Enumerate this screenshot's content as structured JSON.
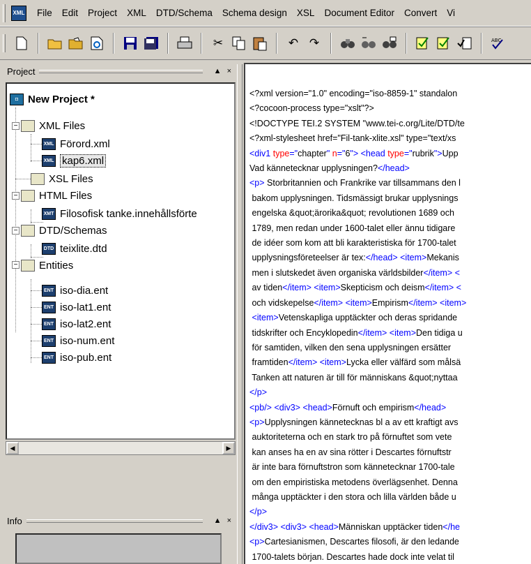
{
  "menu": {
    "app_icon": "XML",
    "items": [
      "File",
      "Edit",
      "Project",
      "XML",
      "DTD/Schema",
      "Schema design",
      "XSL",
      "Document Editor",
      "Convert",
      "Vi"
    ]
  },
  "toolbar": {
    "buttons": [
      "new-file-icon",
      "open-icon",
      "open-url-icon",
      "reload-icon",
      "save-icon",
      "save-all-icon",
      "print-icon",
      "cut-icon",
      "copy-icon",
      "paste-icon",
      "undo-icon",
      "redo-icon",
      "find-icon",
      "find-next-icon",
      "replace-icon",
      "check-wellformed-icon",
      "validate-icon",
      "validate-all-icon",
      "spellcheck-icon"
    ]
  },
  "project_panel": {
    "title": "Project",
    "controls": [
      "▲",
      "×"
    ],
    "tree": {
      "root": "New Project *",
      "xml_folder": "XML Files",
      "xml_files": [
        "Förord.xml",
        "kap6.xml"
      ],
      "xsl_folder": "XSL Files",
      "html_folder": "HTML Files",
      "html_files": [
        "Filosofisk tanke.innehållsförte"
      ],
      "dtd_folder": "DTD/Schemas",
      "dtd_files": [
        "teixlite.dtd"
      ],
      "ent_folder": "Entities",
      "ent_files": [
        "iso-dia.ent",
        "iso-lat1.ent",
        "iso-lat2.ent",
        "iso-num.ent",
        "iso-pub.ent"
      ]
    },
    "icon_labels": {
      "xml": "XML",
      "xmt": "XMT",
      "dtd": "DTD",
      "ent": "ENT"
    }
  },
  "info_panel": {
    "title": "Info",
    "controls": [
      "▲",
      "×"
    ]
  },
  "editor": {
    "lines": [
      [
        [
          "x",
          "<?xml version=\"1.0\" encoding=\"iso-8859-1\" standalon"
        ]
      ],
      [
        [
          "x",
          "<?cocoon-process type=\"xslt\"?>"
        ]
      ],
      [
        [
          "x",
          "<!DOCTYPE TEI.2 SYSTEM \"www.tei-c.org/Lite/DTD/te"
        ]
      ],
      [
        [
          "x",
          "<?xml-stylesheet href=\"Fil-tank-xlite.xsl\" type=\"text/xs"
        ]
      ],
      [
        [
          "t",
          "<div1 "
        ],
        [
          "a",
          "type"
        ],
        [
          "t",
          "=\""
        ],
        [
          "x",
          "chapter"
        ],
        [
          "t",
          "\" "
        ],
        [
          "a",
          "n"
        ],
        [
          "t",
          "=\""
        ],
        [
          "x",
          "6"
        ],
        [
          "t",
          "\"> <head "
        ],
        [
          "a",
          "type"
        ],
        [
          "t",
          "=\""
        ],
        [
          "x",
          "rubrik"
        ],
        [
          "t",
          "\">"
        ],
        [
          "x",
          "Upp"
        ]
      ],
      [
        [
          "x",
          "Vad kännetecknar upplysningen?"
        ],
        [
          "t",
          "</head>"
        ]
      ],
      [
        [
          "t",
          "<p> "
        ],
        [
          "x",
          "Storbritannien och Frankrike var tillsammans den l"
        ]
      ],
      [
        [
          "x",
          " bakom upplysningen. Tidsmässigt brukar upplysnings"
        ]
      ],
      [
        [
          "x",
          " engelska &quot;ärorika&quot; revolutionen 1689 och"
        ]
      ],
      [
        [
          "x",
          " 1789, men redan under 1600-talet eller ännu tidigare"
        ]
      ],
      [
        [
          "x",
          " de idéer som kom att bli karakteristiska för 1700-talet"
        ]
      ],
      [
        [
          "x",
          " upplysningsföreteelser är tex:"
        ],
        [
          "t",
          "</head> <item>"
        ],
        [
          "x",
          "Mekanis"
        ]
      ],
      [
        [
          "x",
          " men i slutskedet även organiska världsbilder"
        ],
        [
          "t",
          "</item> <"
        ]
      ],
      [
        [
          "x",
          " av tiden"
        ],
        [
          "t",
          "</item> <item>"
        ],
        [
          "x",
          "Skepticism och deism"
        ],
        [
          "t",
          "</item> <"
        ]
      ],
      [
        [
          "x",
          " och vidskepelse"
        ],
        [
          "t",
          "</item> <item>"
        ],
        [
          "x",
          "Empirism"
        ],
        [
          "t",
          "</item> <item>"
        ]
      ],
      [
        [
          "t",
          " <item>"
        ],
        [
          "x",
          "Vetenskapliga upptäckter och deras spridande"
        ]
      ],
      [
        [
          "x",
          " tidskrifter och Encyklopedin"
        ],
        [
          "t",
          "</item> <item>"
        ],
        [
          "x",
          "Den tidiga u"
        ]
      ],
      [
        [
          "x",
          " för samtiden, vilken den sena upplysningen ersätter"
        ]
      ],
      [
        [
          "x",
          " framtiden"
        ],
        [
          "t",
          "</item> <item>"
        ],
        [
          "x",
          "Lycka eller välfärd som målsä"
        ]
      ],
      [
        [
          "x",
          " Tanken att naturen är till för människans &quot;nyttaa"
        ]
      ],
      [
        [
          "t",
          "</p>"
        ]
      ],
      [
        [
          "t",
          "<pb/> <div3> <head>"
        ],
        [
          "x",
          "Förnuft och empirism"
        ],
        [
          "t",
          "</head>"
        ]
      ],
      [
        [
          "t",
          "<p>"
        ],
        [
          "x",
          "Upplysningen kännetecknas bl a av ett kraftigt avs"
        ]
      ],
      [
        [
          "x",
          " auktoriteterna och en stark tro på förnuftet som vete"
        ]
      ],
      [
        [
          "x",
          " kan anses ha en av sina rötter i Descartes förnuftstr"
        ]
      ],
      [
        [
          "x",
          " är inte bara förnuftstron som kännetecknar 1700-tale"
        ]
      ],
      [
        [
          "x",
          " om den empiristiska metodens överlägsenhet. Denna"
        ]
      ],
      [
        [
          "x",
          " många upptäckter i den stora och lilla världen både u"
        ]
      ],
      [
        [
          "t",
          "</p>"
        ]
      ],
      [
        [
          "t",
          "</div3> <div3> <head>"
        ],
        [
          "x",
          "Människan upptäcker tiden"
        ],
        [
          "t",
          "</he"
        ]
      ],
      [
        [
          "t",
          "<p>"
        ],
        [
          "x",
          "Cartesianismen, Descartes filosofi, är den ledande"
        ]
      ],
      [
        [
          "x",
          " 1700-talets början. Descartes hade dock inte velat til"
        ]
      ]
    ]
  }
}
